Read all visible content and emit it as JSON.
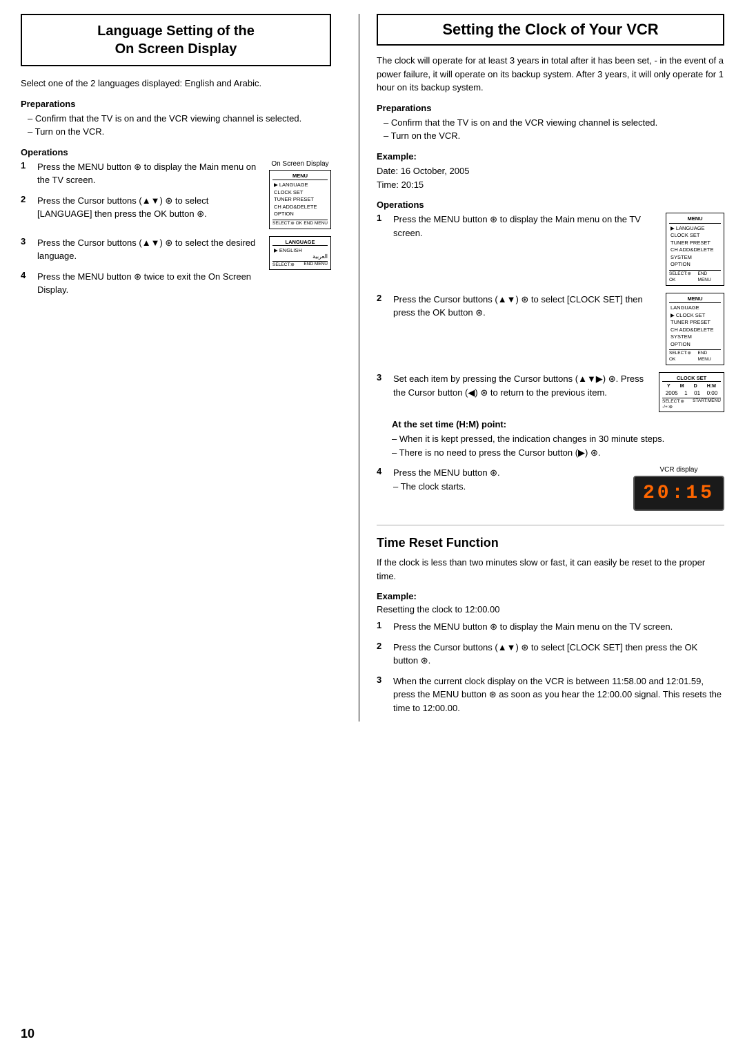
{
  "page": {
    "number": "10",
    "left_section": {
      "title_line1": "Language Setting of the",
      "title_line2": "On Screen Display",
      "intro": "Select one of the 2 languages displayed: English and Arabic.",
      "preparations_heading": "Preparations",
      "preparations": [
        "– Confirm that the TV is on and the VCR viewing channel is selected.",
        "– Turn on the VCR."
      ],
      "operations_heading": "Operations",
      "screen_label": "On Screen Display",
      "operations": [
        {
          "num": "1",
          "text": "Press the MENU button ⊛ to display the Main menu on the TV screen."
        },
        {
          "num": "2",
          "text": "Press the Cursor buttons (▲▼) ⊛ to select [LANGUAGE] then press the OK button ⊛."
        },
        {
          "num": "3",
          "text": "Press the Cursor buttons (▲▼) ⊛ to select the desired language."
        },
        {
          "num": "4",
          "text": "Press the MENU button ⊛ twice to exit the On Screen Display."
        }
      ],
      "osd_menu": {
        "title": "MENU",
        "items": [
          "▶LANGUAGE",
          "CLOCK SET",
          "TUNER PRESET",
          "CH ADD&DELETE",
          "OPTION"
        ],
        "footer_left": "SELECT:⊛  OK",
        "footer_right": "END    MENU"
      },
      "lang_menu": {
        "title": "LANGUAGE",
        "items": [
          "▶ENGLISH",
          "العربية"
        ],
        "footer_left": "SELECT:⊛",
        "footer_right": "END    MENU"
      }
    },
    "right_section": {
      "title": "Setting the Clock of Your VCR",
      "intro": "The clock will operate for at least 3 years in total after it has been set, - in the event of a power failure, it will operate on its backup system. After 3 years, it will only operate for 1 hour on its backup system.",
      "preparations_heading": "Preparations",
      "preparations": [
        "– Confirm that the TV is on and the VCR viewing channel is selected.",
        "– Turn on the VCR."
      ],
      "example_heading": "Example:",
      "example_lines": [
        "Date:  16 October, 2005",
        "Time:  20:15"
      ],
      "operations_heading": "Operations",
      "operations": [
        {
          "num": "1",
          "text": "Press the MENU button ⊛ to display the Main menu on the TV screen."
        },
        {
          "num": "2",
          "text": "Press the Cursor buttons (▲▼) ⊛ to select [CLOCK SET] then press the OK button ⊛."
        },
        {
          "num": "3",
          "text": "Set each item by pressing the Cursor buttons (▲▼▶) ⊛. Press the Cursor button (◀) ⊛ to return to the previous item."
        },
        {
          "num": "4",
          "text": "Press the MENU button ⊛.\n– The clock starts."
        }
      ],
      "at_set_time_heading": "At the set time (H:M) point:",
      "at_set_time_bullets": [
        "– When it is kept pressed, the indication changes in 30 minute steps.",
        "– There is no need to press the Cursor button (▶) ⊛."
      ],
      "vcr_label": "VCR display",
      "vcr_time": "20:15",
      "menu_screen1": {
        "title": "MENU",
        "items": [
          "▶LANGUAGE",
          "CLOCK SET",
          "TUNER PRESET",
          "CH ADD&DELETE",
          "SYSTEM",
          "OPTION"
        ],
        "footer_left": "SELECT:⊛  OK",
        "footer_right": "END    MENU"
      },
      "menu_screen2": {
        "title": "MENU",
        "items": [
          "LANGUAGE",
          "▶CLOCK SET",
          "TUNER PRESET",
          "CH ADD&DELETE",
          "SYSTEM",
          "OPTION"
        ],
        "footer_left": "SELECT:⊛  OK",
        "footer_right": "END    MENU"
      },
      "clock_screen": {
        "title": "CLOCK SET",
        "row_labels": [
          "Y",
          "M",
          "D",
          "H:M"
        ],
        "row_values": [
          "2005",
          "1",
          "01",
          "0:00"
        ],
        "footer_left": "SELECT:⊛  -/+:⊛",
        "footer_right": "START:MENU"
      }
    },
    "time_reset": {
      "title": "Time Reset Function",
      "intro": "If the clock is less than two minutes slow or fast, it can easily be reset to the proper time.",
      "example_heading": "Example:",
      "example_text": "Resetting the clock to 12:00.00",
      "operations": [
        {
          "num": "1",
          "text": "Press the MENU button ⊛ to display the Main menu on the TV screen."
        },
        {
          "num": "2",
          "text": "Press the Cursor buttons (▲▼) ⊛ to select [CLOCK SET] then press the OK button ⊛."
        },
        {
          "num": "3",
          "text": "When the current clock display on the VCR is between 11:58.00 and 12:01.59, press the MENU button ⊛ as soon as you hear the 12:00.00 signal. This resets the time to 12:00.00."
        }
      ]
    }
  }
}
